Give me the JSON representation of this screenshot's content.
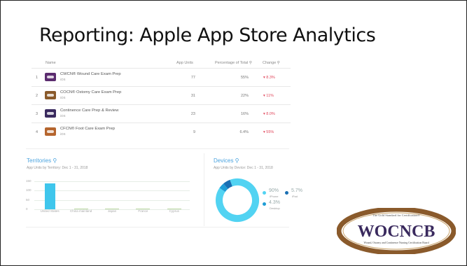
{
  "slide_title": "Reporting: Apple App Store Analytics",
  "table": {
    "headers": {
      "name": "Name",
      "units": "App Units",
      "pct": "Percentage of Total ⚲",
      "change": "Change ⚲"
    },
    "rows": [
      {
        "rank": "1",
        "name": "CWCN® Wound Care Exam Prep",
        "platform": "iOS",
        "units": "77",
        "pct": "55%",
        "change": "▾ 8.3%",
        "icon_color": "#5b2c6f"
      },
      {
        "rank": "2",
        "name": "COCN® Ostomy Care Exam Prep",
        "platform": "iOS",
        "units": "31",
        "pct": "22%",
        "change": "▾ 11%",
        "icon_color": "#8a5a2b"
      },
      {
        "rank": "3",
        "name": "Continence Care Prep & Review",
        "platform": "iOS",
        "units": "23",
        "pct": "16%",
        "change": "▾ 8.0%",
        "icon_color": "#3a2a5e"
      },
      {
        "rank": "4",
        "name": "CFCN® Foot Care Exam Prep",
        "platform": "iOS",
        "units": "9",
        "pct": "6.4%",
        "change": "▾ 55%",
        "icon_color": "#b5652e"
      }
    ]
  },
  "territories": {
    "title": "Territories ⚲",
    "subtitle": "App Units by Territory: Dec 1 - 31, 2018",
    "chart_data": {
      "type": "bar",
      "categories": [
        "United States",
        "China mainland",
        "Japan",
        "France",
        "Cyprus"
      ],
      "values": [
        138,
        1,
        1,
        1,
        1
      ],
      "ylim": [
        0,
        150
      ],
      "ytick_labels": [
        "150",
        "100",
        "50",
        "0"
      ],
      "bar_colors": [
        "#3fc6ec",
        "#b8d6a0",
        "#b8d6a0",
        "#b8d6a0",
        "#b8d6a0"
      ],
      "grid": true
    }
  },
  "devices": {
    "title": "Devices ⚲",
    "subtitle": "App Units by Device: Dec 1 - 31, 2018",
    "chart_data": {
      "type": "pie",
      "style": "donut",
      "labels": [
        "iPhone",
        "Desktop",
        "iPad"
      ],
      "values": [
        90,
        4.3,
        5.7
      ],
      "value_labels": [
        "90%",
        "4.3%",
        "5.7%"
      ],
      "colors": [
        "#52d3f2",
        "#1f9dd6",
        "#1a6fb3"
      ]
    }
  },
  "logo": {
    "tagline": "The Gold Standard for Certification®",
    "wordmark": "WOCNCB",
    "subline": "Wound, Ostomy and Continence Nursing Certification Board",
    "ring_color": "#8a5a2b",
    "text_color": "#3a2a5e"
  }
}
